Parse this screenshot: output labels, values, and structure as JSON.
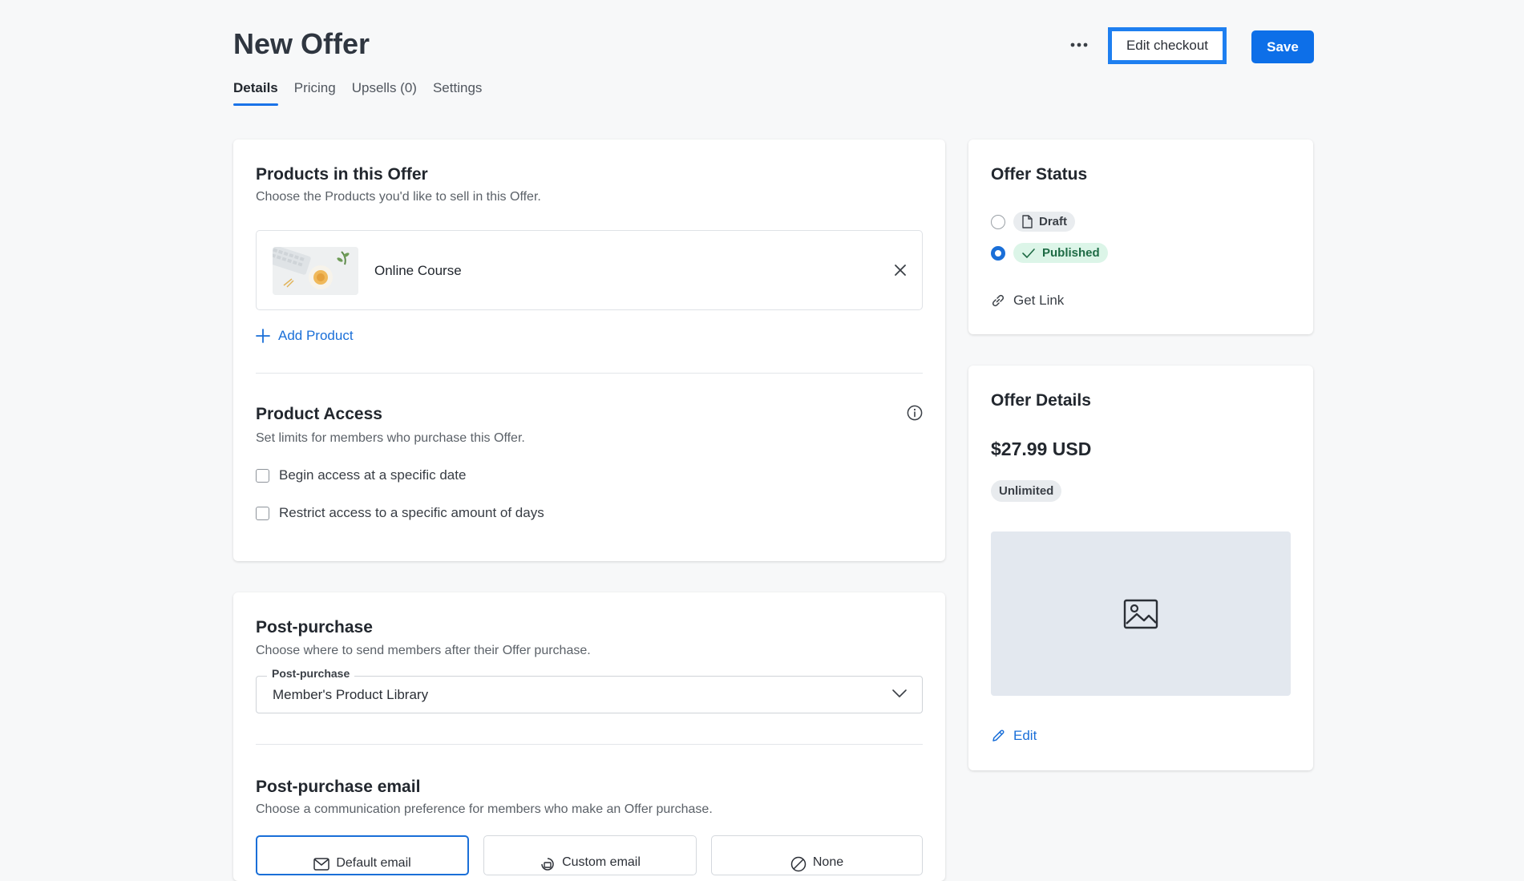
{
  "page": {
    "title": "New Offer",
    "tabs": [
      {
        "label": "Details",
        "active": true
      },
      {
        "label": "Pricing",
        "active": false
      },
      {
        "label": "Upsells (0)",
        "active": false
      },
      {
        "label": "Settings",
        "active": false
      }
    ]
  },
  "header_actions": {
    "more_icon": "more-horizontal-icon",
    "edit_checkout_label": "Edit checkout",
    "save_label": "Save"
  },
  "products_section": {
    "title": "Products in this Offer",
    "subtitle": "Choose the Products you'd like to sell in this Offer.",
    "products": [
      {
        "name": "Online Course"
      }
    ],
    "add_product_label": "Add Product"
  },
  "access_section": {
    "title": "Product Access",
    "subtitle": "Set limits for members who purchase this Offer.",
    "options": [
      {
        "label": "Begin access at a specific date",
        "checked": false
      },
      {
        "label": "Restrict access to a specific amount of days",
        "checked": false
      }
    ]
  },
  "post_purchase_section": {
    "title": "Post-purchase",
    "subtitle": "Choose where to send members after their Offer purchase.",
    "select_label": "Post-purchase",
    "select_value": "Member's Product Library"
  },
  "email_section": {
    "title": "Post-purchase email",
    "subtitle": "Choose a communication preference for members who make an Offer purchase.",
    "options": [
      {
        "label": "Default email",
        "selected": true
      },
      {
        "label": "Custom email",
        "selected": false
      },
      {
        "label": "None",
        "selected": false
      }
    ]
  },
  "status_card": {
    "title": "Offer Status",
    "options": [
      {
        "label": "Draft",
        "checked": false
      },
      {
        "label": "Published",
        "checked": true
      }
    ],
    "get_link_label": "Get Link"
  },
  "details_card": {
    "title": "Offer Details",
    "price": "$27.99 USD",
    "badge": "Unlimited",
    "edit_label": "Edit"
  },
  "colors": {
    "accent": "#1a6fd8",
    "save_button": "#0d6fe8",
    "published_bg": "#dcf5e8",
    "published_text": "#1e6b45"
  }
}
